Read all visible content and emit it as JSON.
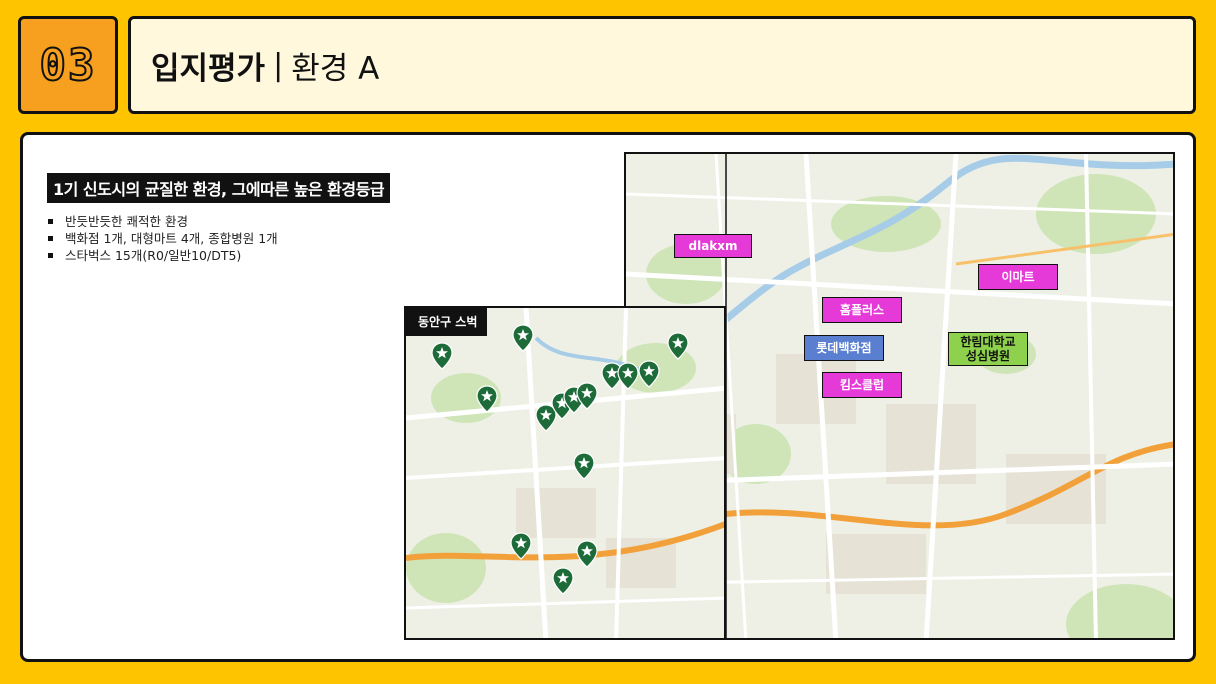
{
  "header": {
    "section_number": "03",
    "title_main": "입지평가",
    "title_separator": "|",
    "title_sub": "환경 A"
  },
  "content": {
    "headline": "1기 신도시의 균질한 환경, 그에따른 높은 환경등급",
    "bullets": [
      "반듯반듯한 쾌적한 환경",
      "백화점 1개, 대형마트 4개, 종합병원 1개",
      "스타벅스 15개(R0/일반10/DT5)"
    ]
  },
  "map_small": {
    "label": "동안구 스벅",
    "pin_count": 15,
    "pin_color": "#1E6B3A"
  },
  "map_big": {
    "tags": {
      "t1": "dlakxm",
      "t2": "이마트",
      "t3": "홈플러스",
      "t4": "롯데백화점",
      "t5": "킴스클럽",
      "t6_line1": "한림대학교",
      "t6_line2": "성심병원"
    }
  },
  "colors": {
    "background": "#FFC400",
    "accent": "#F7A01F",
    "title_bg": "#FFF8DD",
    "tag_pink": "#E63AD8",
    "tag_blue": "#5A7FD0",
    "tag_green": "#8ED14C"
  }
}
